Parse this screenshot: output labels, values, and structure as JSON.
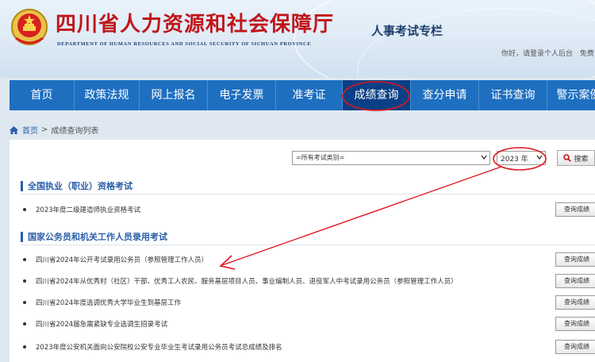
{
  "header": {
    "title": "四川省人力资源和社会保障厅",
    "subtitle": "DEPARTMENT OF HUMAN RESOURCES AND SOCIAL SECURITY OF SICHUAN PROVINCE",
    "section": "人事考试专栏",
    "greeting": "你好，请登录个人后台",
    "login_link": "免费"
  },
  "nav": {
    "items": [
      {
        "label": "首页",
        "width": 82
      },
      {
        "label": "政策法规",
        "width": 82
      },
      {
        "label": "网上报名",
        "width": 86
      },
      {
        "label": "电子发票",
        "width": 86
      },
      {
        "label": "准考证",
        "width": 84
      },
      {
        "label": "成绩查询",
        "width": 86
      },
      {
        "label": "查分申请",
        "width": 86
      },
      {
        "label": "证书查询",
        "width": 86
      },
      {
        "label": "警示案例",
        "width": 80
      }
    ],
    "active_index": 5
  },
  "breadcrumb": {
    "home": "首页",
    "separator": ">",
    "current": "成绩查询列表"
  },
  "filters": {
    "category_value": "=所有考试类别=",
    "year_value": "2023 年",
    "search_label": "搜索"
  },
  "categories": [
    {
      "title": "全国执业（职业）资格考试",
      "items": [
        {
          "title": "2023年度二级建造师执业资格考试",
          "button": "查询成绩"
        }
      ]
    },
    {
      "title": "国家公务员和机关工作人员录用考试",
      "items": [
        {
          "title": "四川省2024年公开考试录用公务员（参照管理工作人员）",
          "button": "查询成绩"
        },
        {
          "title": "四川省2024年从优秀村（社区）干部、优秀工人农民、服务基层项目人员、事业编制人员、退役军人中考试录用公务员（参照管理工作人员）",
          "button": "查询成绩"
        },
        {
          "title": "四川省2024年度选调优秀大学毕业生到基层工作",
          "button": "查询成绩"
        },
        {
          "title": "四川省2024届急需紧缺专业选调生招录考试",
          "button": "查询成绩"
        },
        {
          "title": "2023年度公安机关面向公安院校公安专业毕业生考试录用公务员考试总成绩及排名",
          "button": "查询成绩"
        }
      ]
    }
  ],
  "colors": {
    "nav_bg": "#1e6fc0",
    "nav_active": "#0b3f86",
    "title_red": "#c0161b",
    "link_blue": "#2a5ea8",
    "annotation_red": "#e0161e"
  },
  "icons": {
    "emblem": "national-emblem-icon",
    "home": "home-icon",
    "search": "search-icon",
    "dropdown": "chevron-down-icon"
  }
}
